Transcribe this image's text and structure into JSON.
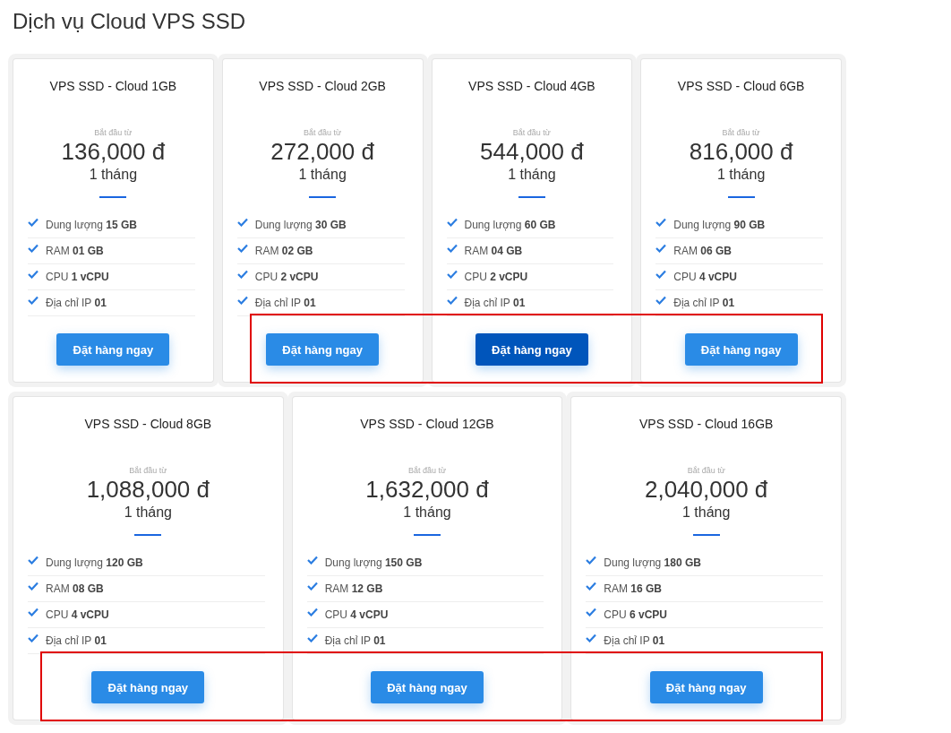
{
  "heading": "Dịch vụ Cloud VPS SSD",
  "rows": [
    {
      "cards": [
        {
          "title": "VPS SSD - Cloud 1GB",
          "price_label": "Bắt đầu từ",
          "price": "136,000 đ",
          "period": "1 tháng",
          "features": [
            "Dung lượng **15 GB**",
            "RAM **01 GB**",
            "CPU **1 vCPU**",
            "Địa chỉ IP **01**"
          ],
          "button": {
            "label": "Đặt hàng ngay",
            "active": false
          },
          "highlighted": false
        },
        {
          "title": "VPS SSD - Cloud 2GB",
          "price_label": "Bắt đầu từ",
          "price": "272,000 đ",
          "period": "1 tháng",
          "features": [
            "Dung lượng **30 GB**",
            "RAM **02 GB**",
            "CPU **2 vCPU**",
            "Địa chỉ IP **01**"
          ],
          "button": {
            "label": "Đặt hàng ngay",
            "active": false
          },
          "highlighted": true
        },
        {
          "title": "VPS SSD - Cloud 4GB",
          "price_label": "Bắt đầu từ",
          "price": "544,000 đ",
          "period": "1 tháng",
          "features": [
            "Dung lượng **60 GB**",
            "RAM **04 GB**",
            "CPU **2 vCPU**",
            "Địa chỉ IP **01**"
          ],
          "button": {
            "label": "Đặt hàng ngay",
            "active": true
          },
          "highlighted": true
        },
        {
          "title": "VPS SSD - Cloud 6GB",
          "price_label": "Bắt đầu từ",
          "price": "816,000 đ",
          "period": "1 tháng",
          "features": [
            "Dung lượng **90 GB**",
            "RAM **06 GB**",
            "CPU **4 vCPU**",
            "Địa chỉ IP **01**"
          ],
          "button": {
            "label": "Đặt hàng ngay",
            "active": false
          },
          "highlighted": true
        }
      ]
    },
    {
      "cards": [
        {
          "title": "VPS SSD - Cloud 8GB",
          "price_label": "Bắt đầu từ",
          "price": "1,088,000 đ",
          "period": "1 tháng",
          "features": [
            "Dung lượng **120 GB**",
            "RAM **08 GB**",
            "CPU **4 vCPU**",
            "Địa chỉ IP **01**"
          ],
          "button": {
            "label": "Đặt hàng ngay",
            "active": false
          },
          "highlighted": true
        },
        {
          "title": "VPS SSD - Cloud 12GB",
          "price_label": "Bắt đầu từ",
          "price": "1,632,000 đ",
          "period": "1 tháng",
          "features": [
            "Dung lượng **150 GB**",
            "RAM **12 GB**",
            "CPU **4 vCPU**",
            "Địa chỉ IP **01**"
          ],
          "button": {
            "label": "Đặt hàng ngay",
            "active": false
          },
          "highlighted": true
        },
        {
          "title": "VPS SSD - Cloud 16GB",
          "price_label": "Bắt đầu từ",
          "price": "2,040,000 đ",
          "period": "1 tháng",
          "features": [
            "Dung lượng **180 GB**",
            "RAM **16 GB**",
            "CPU **6 vCPU**",
            "Địa chỉ IP **01**"
          ],
          "button": {
            "label": "Đặt hàng ngay",
            "active": false
          },
          "highlighted": true
        }
      ]
    }
  ]
}
